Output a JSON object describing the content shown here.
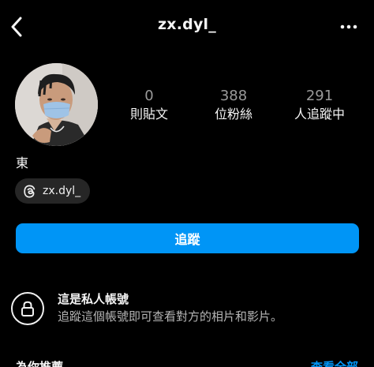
{
  "header": {
    "username": "zx.dyl_",
    "back_icon": "chevron-left-icon",
    "more_icon": "more-horizontal-icon"
  },
  "profile": {
    "avatar_icon": "profile-photo",
    "display_name": "東",
    "stats": [
      {
        "count": "0",
        "label": "則貼文"
      },
      {
        "count": "388",
        "label": "位粉絲"
      },
      {
        "count": "291",
        "label": "人追蹤中"
      }
    ],
    "threads": {
      "icon": "threads-icon",
      "handle": "zx.dyl_"
    }
  },
  "actions": {
    "follow_label": "追蹤",
    "accent": "#0095f6"
  },
  "private_account": {
    "icon": "lock-icon",
    "title": "這是私人帳號",
    "description": "追蹤這個帳號即可查看對方的相片和影片。"
  },
  "suggestions": {
    "title": "為你推薦",
    "see_all": "查看全部"
  }
}
